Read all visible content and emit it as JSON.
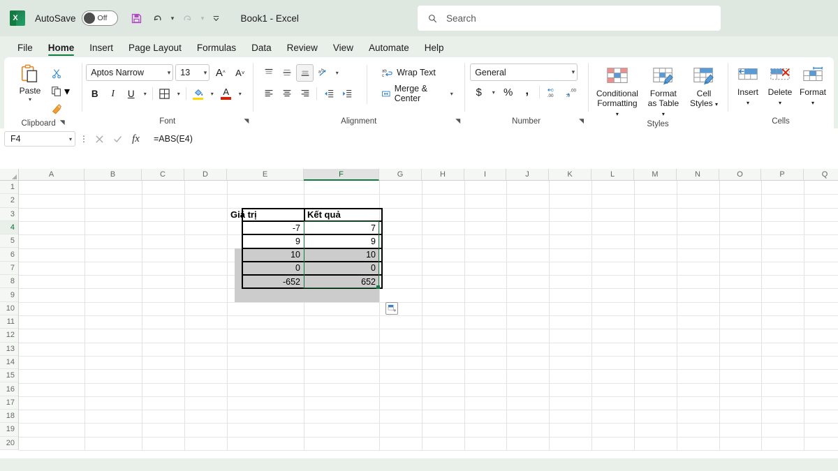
{
  "titlebar": {
    "app_logo": "excel-logo",
    "autosave_label": "AutoSave",
    "autosave_state": "Off",
    "document_title": "Book1  -  Excel",
    "qat": [
      {
        "name": "save",
        "icon": "save-icon"
      },
      {
        "name": "undo",
        "icon": "undo-icon"
      },
      {
        "name": "redo",
        "icon": "redo-icon"
      },
      {
        "name": "customize-quick-access-toolbar",
        "icon": "chevron-down-icon"
      }
    ]
  },
  "search": {
    "placeholder": "Search",
    "icon": "search-icon"
  },
  "tabs": [
    {
      "label": "File",
      "active": false
    },
    {
      "label": "Home",
      "active": true
    },
    {
      "label": "Insert",
      "active": false
    },
    {
      "label": "Page Layout",
      "active": false
    },
    {
      "label": "Formulas",
      "active": false
    },
    {
      "label": "Data",
      "active": false
    },
    {
      "label": "Review",
      "active": false
    },
    {
      "label": "View",
      "active": false
    },
    {
      "label": "Automate",
      "active": false
    },
    {
      "label": "Help",
      "active": false
    }
  ],
  "ribbon": {
    "clipboard": {
      "group_label": "Clipboard",
      "paste_label": "Paste",
      "cut_label": "Cut",
      "copy_label": "Copy",
      "format_painter_label": "Format Painter"
    },
    "font": {
      "group_label": "Font",
      "font_family_value": "Aptos Narrow",
      "font_size_value": "13",
      "grow_font": "A",
      "shrink_font": "A",
      "bold": "B",
      "italic": "I",
      "underline": "U",
      "borders": "borders-icon",
      "fill_color": "fill-color-icon",
      "font_color": "A"
    },
    "alignment": {
      "group_label": "Alignment",
      "wrap_text_label": "Wrap Text",
      "merge_center_label": "Merge & Center",
      "align_top": "align-top-icon",
      "align_middle": "align-middle-icon",
      "align_bottom": "align-bottom-icon",
      "orientation": "orientation-icon",
      "align_left": "align-left-icon",
      "align_center": "align-center-icon",
      "align_right": "align-right-icon",
      "decrease_indent": "decrease-indent-icon",
      "increase_indent": "increase-indent-icon"
    },
    "number": {
      "group_label": "Number",
      "format_value": "General",
      "accounting": "$",
      "percent": "%",
      "comma": ",",
      "increase_decimal": ".00",
      "decrease_decimal": ".00"
    },
    "styles": {
      "group_label": "Styles",
      "conditional_formatting": "Conditional Formatting",
      "format_as_table": "Format as Table",
      "cell_styles": "Cell Styles"
    },
    "cells": {
      "group_label": "Cells",
      "insert": "Insert",
      "delete": "Delete",
      "format": "Format"
    }
  },
  "formula_bar": {
    "name_box_value": "F4",
    "cancel_icon": "cancel-icon",
    "enter_icon": "check-icon",
    "function_icon": "fx-icon",
    "formula_value": "=ABS(E4)"
  },
  "grid": {
    "columns": [
      "A",
      "B",
      "C",
      "D",
      "E",
      "F",
      "G",
      "H",
      "I",
      "J",
      "K",
      "L",
      "M",
      "N",
      "O",
      "P",
      "Q"
    ],
    "active_column": "F",
    "rows": [
      1,
      2,
      3,
      4,
      5,
      6,
      7,
      8,
      9,
      10,
      11,
      12,
      13,
      14,
      15,
      16,
      17,
      18,
      19,
      20
    ],
    "active_row": 4,
    "table": {
      "headers": [
        "Giá trị",
        "Kết quả"
      ],
      "header_row": 3,
      "columns": [
        "E",
        "F"
      ],
      "rows": [
        {
          "row": 4,
          "value": "-7",
          "result": "7"
        },
        {
          "row": 5,
          "value": "9",
          "result": "9"
        },
        {
          "row": 6,
          "value": "10",
          "result": "10"
        },
        {
          "row": 7,
          "value": "0",
          "result": "0"
        },
        {
          "row": 8,
          "value": "-652",
          "result": "652"
        }
      ]
    },
    "selection": {
      "range": "F4:F8",
      "active_cell": "F4",
      "fill_color": "#cccccc"
    },
    "autofill_options": "auto-fill-options-icon"
  },
  "colors": {
    "accent_green": "#107c41",
    "titlebar_bg": "#dfe8e0",
    "ribbon_bg": "#ffffff",
    "selection_border": "#137a45"
  }
}
